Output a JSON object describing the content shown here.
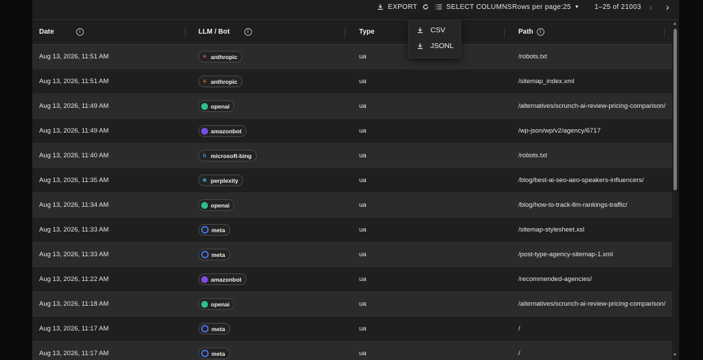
{
  "toolbar": {
    "export_label": "EXPORT",
    "select_columns_label": "SELECT COLUMNS",
    "rows_per_page_label": "Rows per page:",
    "rows_per_page_value": "25",
    "pagination": "1–25 of 21003"
  },
  "export_menu": {
    "csv": "CSV",
    "jsonl": "JSONL"
  },
  "columns": {
    "date": "Date",
    "bot": "LLM / Bot",
    "type": "Type",
    "path": "Path"
  },
  "bot_colors": {
    "anthropic": "#e07a4f",
    "openai": "#2fbf8f",
    "amazonbot": "#7a4de0",
    "microsoft-bing": "#3a8fe0",
    "perplexity": "#2fa8b8",
    "meta": "#4a6ee0"
  },
  "rows": [
    {
      "date": "Aug 13, 2026, 11:51 AM",
      "bot": "anthropic",
      "type": "ua",
      "path": "/robots.txt"
    },
    {
      "date": "Aug 13, 2026, 11:51 AM",
      "bot": "anthropic",
      "type": "ua",
      "path": "/sitemap_index.xml"
    },
    {
      "date": "Aug 13, 2026, 11:49 AM",
      "bot": "openai",
      "type": "ua",
      "path": "/alternatives/scrunch-ai-review-pricing-comparison/"
    },
    {
      "date": "Aug 13, 2026, 11:49 AM",
      "bot": "amazonbot",
      "type": "ua",
      "path": "/wp-json/wp/v2/agency/6717"
    },
    {
      "date": "Aug 13, 2026, 11:40 AM",
      "bot": "microsoft-bing",
      "type": "ua",
      "path": "/robots.txt"
    },
    {
      "date": "Aug 13, 2026, 11:35 AM",
      "bot": "perplexity",
      "type": "ua",
      "path": "/blog/best-ai-seo-aeo-speakers-influencers/"
    },
    {
      "date": "Aug 13, 2026, 11:34 AM",
      "bot": "openai",
      "type": "ua",
      "path": "/blog/how-to-track-llm-rankings-traffic/"
    },
    {
      "date": "Aug 13, 2026, 11:33 AM",
      "bot": "meta",
      "type": "ua",
      "path": "/sitemap-stylesheet.xsl"
    },
    {
      "date": "Aug 13, 2026, 11:33 AM",
      "bot": "meta",
      "type": "ua",
      "path": "/post-type-agency-sitemap-1.xml"
    },
    {
      "date": "Aug 13, 2026, 11:22 AM",
      "bot": "amazonbot",
      "type": "ua",
      "path": "/recommended-agencies/"
    },
    {
      "date": "Aug 13, 2026, 11:18 AM",
      "bot": "openai",
      "type": "ua",
      "path": "/alternatives/scrunch-ai-review-pricing-comparison/"
    },
    {
      "date": "Aug 13, 2026, 11:17 AM",
      "bot": "meta",
      "type": "ua",
      "path": "/"
    },
    {
      "date": "Aug 13, 2026, 11:17 AM",
      "bot": "meta",
      "type": "ua",
      "path": "/"
    }
  ]
}
